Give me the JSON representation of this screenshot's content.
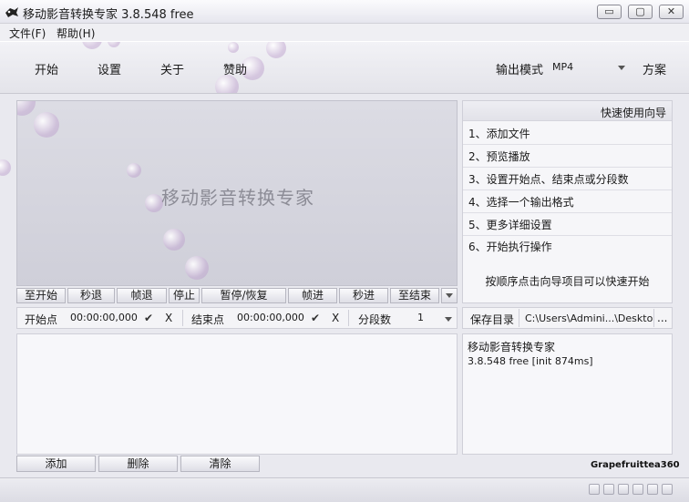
{
  "window": {
    "title": "移动影音转换专家 3.8.548 free",
    "minimize_glyph": "▭",
    "maximize_glyph": "▢",
    "close_glyph": "✕"
  },
  "menu": {
    "file": "文件(F)",
    "help": "帮助(H)"
  },
  "toolbar": {
    "start": "开始",
    "settings": "设置",
    "about": "关于",
    "donate": "赞助",
    "output_mode_label": "输出模式",
    "output_mode_value": "MP4",
    "scheme": "方案"
  },
  "preview": {
    "title": "移动影音转换专家"
  },
  "controls": {
    "to_start": "至开始",
    "sec_back": "秒退",
    "frame_back": "帧退",
    "stop": "停止",
    "pause_resume": "暂停/恢复",
    "frame_forward": "帧进",
    "sec_forward": "秒进",
    "to_end": "至结束"
  },
  "timing": {
    "start_label": "开始点",
    "start_value": "00:00:00,000",
    "end_label": "结束点",
    "end_value": "00:00:00,000",
    "confirm_glyph": "✔",
    "clear_glyph": "X",
    "segments_label": "分段数",
    "segments_value": "1"
  },
  "guide": {
    "header": "快速使用向导",
    "items": [
      "1、添加文件",
      "2、预览播放",
      "3、设置开始点、结束点或分段数",
      "4、选择一个输出格式",
      "5、更多详细设置",
      "6、开始执行操作"
    ],
    "hint": "按顺序点击向导项目可以快速开始"
  },
  "save": {
    "label": "保存目录",
    "path": "C:\\Users\\Admini...\\Desktop\\",
    "browse": "..."
  },
  "info": {
    "line1": "移动影音转换专家",
    "line2": "3.8.548 free [init 874ms]"
  },
  "list_buttons": {
    "add": "添加",
    "delete": "删除",
    "clear": "清除"
  },
  "credit": "Grapefruittea360"
}
